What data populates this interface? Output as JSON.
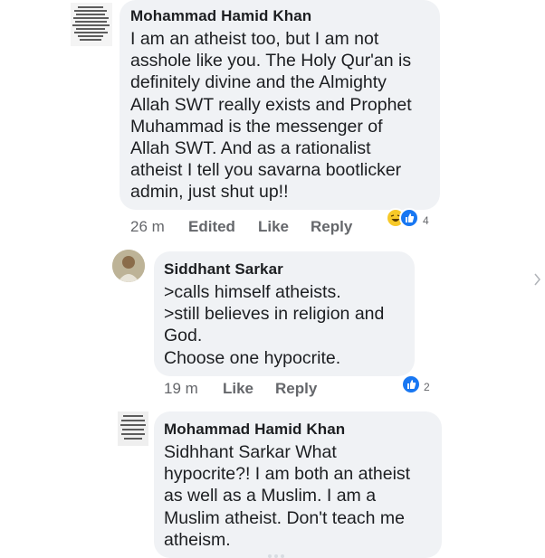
{
  "comments": [
    {
      "author": "Mohammad Hamid Khan",
      "text": "I am an atheist too, but I am not\nasshole like you. The Holy Qur'an is\ndefinitely divine and the Almighty\nAllah SWT really exists and Prophet\nMuhammad is the messenger of\nAllah SWT. And as a rationalist\natheist I tell you savarna bootlicker\nadmin, just shut up!!",
      "time": "26 m",
      "edited": "Edited",
      "like": "Like",
      "reply": "Reply",
      "reaction_count": "4"
    },
    {
      "author": "Siddhant Sarkar",
      "text": ">calls himself atheists.\n>still believes in religion and\nGod.\nChoose one hypocrite.",
      "time": "19 m",
      "like": "Like",
      "reply": "Reply",
      "reaction_count": "2"
    },
    {
      "author": "Mohammad Hamid Khan",
      "text": "Sidhhant Sarkar What\nhypocrite?! I am both an atheist\nas well as a Muslim. I am a\nMuslim atheist. Don't teach me\natheism."
    }
  ],
  "colors": {
    "bubble": "#f0f2f5",
    "meta_text": "#65676b",
    "like_blue": "#1877f2",
    "haha_yellow": "#f7c928"
  },
  "icons": {
    "haha": "haha-reaction-icon",
    "like": "like-reaction-icon",
    "chevron": "chevron-right-icon"
  }
}
